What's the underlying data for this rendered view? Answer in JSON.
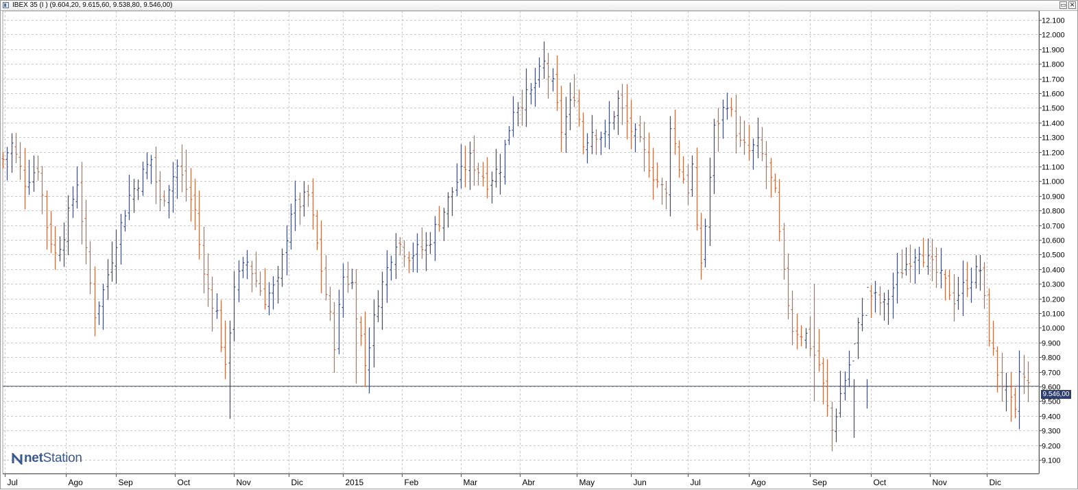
{
  "window": {
    "title": "IBEX 35 (I ) (9.604,20, 9.615,60, 9.538,80, 9.546,00)",
    "restore_glyph": "▭",
    "close_glyph": "✕"
  },
  "logo": {
    "text_prefix": "net",
    "text_suffix": "Station",
    "icon": "netstation-logo-icon",
    "color": "#3a5a8f"
  },
  "colors": {
    "up": "#3b4a7a",
    "down": "#c8683c",
    "reference_line": "#5a6f9a",
    "grid": "#c8c8c8",
    "price_label_bg": "#2e3f6e"
  },
  "chart_data": {
    "type": "ohlc",
    "title": "IBEX 35 (I ) (9.604,20, 9.615,60, 9.538,80, 9.546,00)",
    "ylim": [
      9000,
      12150
    ],
    "y_ticks": [
      "12.100",
      "12.000",
      "11.900",
      "11.800",
      "11.700",
      "11.600",
      "11.500",
      "11.400",
      "11.300",
      "11.200",
      "11.100",
      "11.000",
      "10.900",
      "10.800",
      "10.700",
      "10.600",
      "10.500",
      "10.400",
      "10.300",
      "10.200",
      "10.100",
      "10.000",
      "9.900",
      "9.800",
      "9.700",
      "9.600",
      "9.500",
      "9.400",
      "9.300",
      "9.200",
      "9.100"
    ],
    "x_labels": [
      "Jul",
      "Ago",
      "Sep",
      "Oct",
      "Nov",
      "Dic",
      "2015",
      "Feb",
      "Mar",
      "Abr",
      "May",
      "Jun",
      "Jul",
      "Ago",
      "Sep",
      "Oct",
      "Nov",
      "Dic"
    ],
    "x_label_positions": [
      0.5,
      14.5,
      26,
      39.5,
      53,
      65.5,
      78,
      91.5,
      105,
      118.5,
      131.5,
      144,
      157,
      171,
      185,
      199,
      212.5,
      225.5
    ],
    "bar_count": 236,
    "reference_line": 9604,
    "last_price": "9.546,00",
    "anchors": [
      [
        0,
        11150
      ],
      [
        2,
        11250
      ],
      [
        5,
        11000
      ],
      [
        8,
        11100
      ],
      [
        10,
        10700
      ],
      [
        12,
        10500
      ],
      [
        14,
        10650
      ],
      [
        17,
        11000
      ],
      [
        19,
        10500
      ],
      [
        21,
        10100
      ],
      [
        23,
        10250
      ],
      [
        26,
        10600
      ],
      [
        29,
        10900
      ],
      [
        34,
        11150
      ],
      [
        36,
        10850
      ],
      [
        40,
        11100
      ],
      [
        44,
        10800
      ],
      [
        46,
        10350
      ],
      [
        49,
        10100
      ],
      [
        51,
        9700
      ],
      [
        53,
        10300
      ],
      [
        56,
        10450
      ],
      [
        60,
        10200
      ],
      [
        63,
        10300
      ],
      [
        66,
        10800
      ],
      [
        70,
        10900
      ],
      [
        73,
        10400
      ],
      [
        76,
        9900
      ],
      [
        78,
        10350
      ],
      [
        80,
        10300
      ],
      [
        83,
        9750
      ],
      [
        86,
        10200
      ],
      [
        90,
        10600
      ],
      [
        93,
        10500
      ],
      [
        97,
        10550
      ],
      [
        101,
        10800
      ],
      [
        104,
        11000
      ],
      [
        107,
        11150
      ],
      [
        111,
        11000
      ],
      [
        114,
        11100
      ],
      [
        117,
        11500
      ],
      [
        121,
        11600
      ],
      [
        124,
        11800
      ],
      [
        126,
        11650
      ],
      [
        128,
        11350
      ],
      [
        131,
        11600
      ],
      [
        133,
        11250
      ],
      [
        135,
        11350
      ],
      [
        138,
        11300
      ],
      [
        141,
        11550
      ],
      [
        143,
        11400
      ],
      [
        146,
        11250
      ],
      [
        149,
        11050
      ],
      [
        152,
        10900
      ],
      [
        153,
        11400
      ],
      [
        155,
        11100
      ],
      [
        157,
        10950
      ],
      [
        158,
        11100
      ],
      [
        159,
        10650
      ],
      [
        160,
        10450
      ],
      [
        161,
        10700
      ],
      [
        163,
        11350
      ],
      [
        166,
        11550
      ],
      [
        169,
        11250
      ],
      [
        171,
        11200
      ],
      [
        173,
        11250
      ],
      [
        175,
        11100
      ],
      [
        177,
        10900
      ],
      [
        179,
        10350
      ],
      [
        181,
        10000
      ],
      [
        184,
        9950
      ],
      [
        187,
        9750
      ],
      [
        190,
        9300
      ],
      [
        192,
        9550
      ],
      [
        194,
        9750
      ],
      [
        198,
        10250
      ],
      [
        202,
        10150
      ],
      [
        206,
        10400
      ],
      [
        210,
        10550
      ],
      [
        212,
        10450
      ],
      [
        216,
        10300
      ],
      [
        218,
        10200
      ],
      [
        222,
        10350
      ],
      [
        224,
        10400
      ],
      [
        226,
        9950
      ],
      [
        228,
        9700
      ],
      [
        230,
        9550
      ],
      [
        232,
        9400
      ],
      [
        233,
        9700
      ],
      [
        235,
        9600
      ]
    ],
    "special_bars": [
      [
        51,
        9650,
        10050
      ],
      [
        52,
        9380,
        10050
      ],
      [
        81,
        9620,
        10400
      ],
      [
        164,
        11200,
        11500
      ],
      [
        186,
        9500,
        10300
      ],
      [
        195,
        9250,
        9650
      ],
      [
        198,
        9450,
        9650
      ],
      [
        231,
        9360,
        9700
      ]
    ]
  }
}
